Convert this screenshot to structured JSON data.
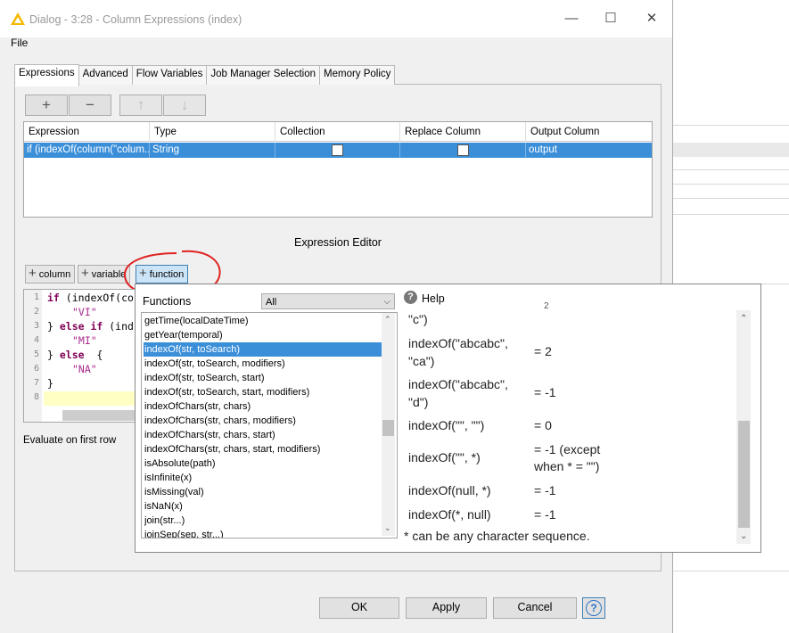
{
  "window": {
    "title": "Dialog - 3:28 - Column Expressions (index)",
    "minimize": "—",
    "maximize": "☐",
    "close": "✕"
  },
  "menu": {
    "file": "File"
  },
  "tabs": [
    "Expressions",
    "Advanced",
    "Flow Variables",
    "Job Manager Selection",
    "Memory Policy"
  ],
  "toolbar": {
    "add": "+",
    "remove": "−",
    "up": "↑",
    "down": "↓"
  },
  "table": {
    "headers": [
      "Expression",
      "Type",
      "Collection",
      "Replace Column",
      "Output Column"
    ],
    "row": {
      "expression": "if (indexOf(column(\"colum...",
      "type": "String",
      "collection": false,
      "replace": false,
      "output": "output"
    }
  },
  "editor": {
    "title": "Expression Editor",
    "add_column": "column",
    "add_variable": "variable",
    "add_function": "function",
    "lines": [
      "1",
      "2",
      "3",
      "4",
      "5",
      "6",
      "7",
      "8"
    ],
    "code": {
      "l1a": "if",
      "l1b": " (indexOf(co",
      "l2": "\"VI\"",
      "l3a": "} ",
      "l3b": "else if",
      "l3c": " (ind",
      "l4": "\"MI\"",
      "l5a": "} ",
      "l5b": "else",
      "l5c": "  {",
      "l6": "\"NA\"",
      "l7": "}"
    },
    "evaluate": "Evaluate on first row"
  },
  "functions": {
    "label": "Functions",
    "category": "All",
    "items": [
      "getTime(localDateTime)",
      "getYear(temporal)",
      "indexOf(str, toSearch)",
      "indexOf(str, toSearch, modifiers)",
      "indexOf(str, toSearch, start)",
      "indexOf(str, toSearch, start, modifiers)",
      "indexOfChars(str, chars)",
      "indexOfChars(str, chars, modifiers)",
      "indexOfChars(str, chars, start)",
      "indexOfChars(str, chars, start, modifiers)",
      "isAbsolute(path)",
      "isInfinite(x)",
      "isMissing(val)",
      "isNaN(x)",
      "join(str...)",
      "joinSep(sep, str...)"
    ],
    "selected_index": 2
  },
  "help": {
    "label": "Help",
    "partial_top": "\"c\")",
    "partial_right": "2",
    "rows": [
      {
        "expr1": "indexOf(\"abcabc\",",
        "expr2": "\"ca\")",
        "result": "= 2"
      },
      {
        "expr1": "indexOf(\"abcabc\",",
        "expr2": "\"d\")",
        "result": "= -1"
      },
      {
        "expr1": "indexOf(\"\", \"\")",
        "expr2": "",
        "result": "= 0"
      },
      {
        "expr1": "indexOf(\"\", *)",
        "expr2": "",
        "result": "= -1 (except",
        "result2": "when * = \"\")"
      },
      {
        "expr1": "indexOf(null, *)",
        "expr2": "",
        "result": "= -1"
      },
      {
        "expr1": "indexOf(*, null)",
        "expr2": "",
        "result": "= -1"
      }
    ],
    "note": "* can be any character sequence."
  },
  "buttons": {
    "ok": "OK",
    "apply": "Apply",
    "cancel": "Cancel",
    "help": "?"
  },
  "colors": {
    "selection": "#3b8fd9",
    "annotation": "#e02020"
  }
}
